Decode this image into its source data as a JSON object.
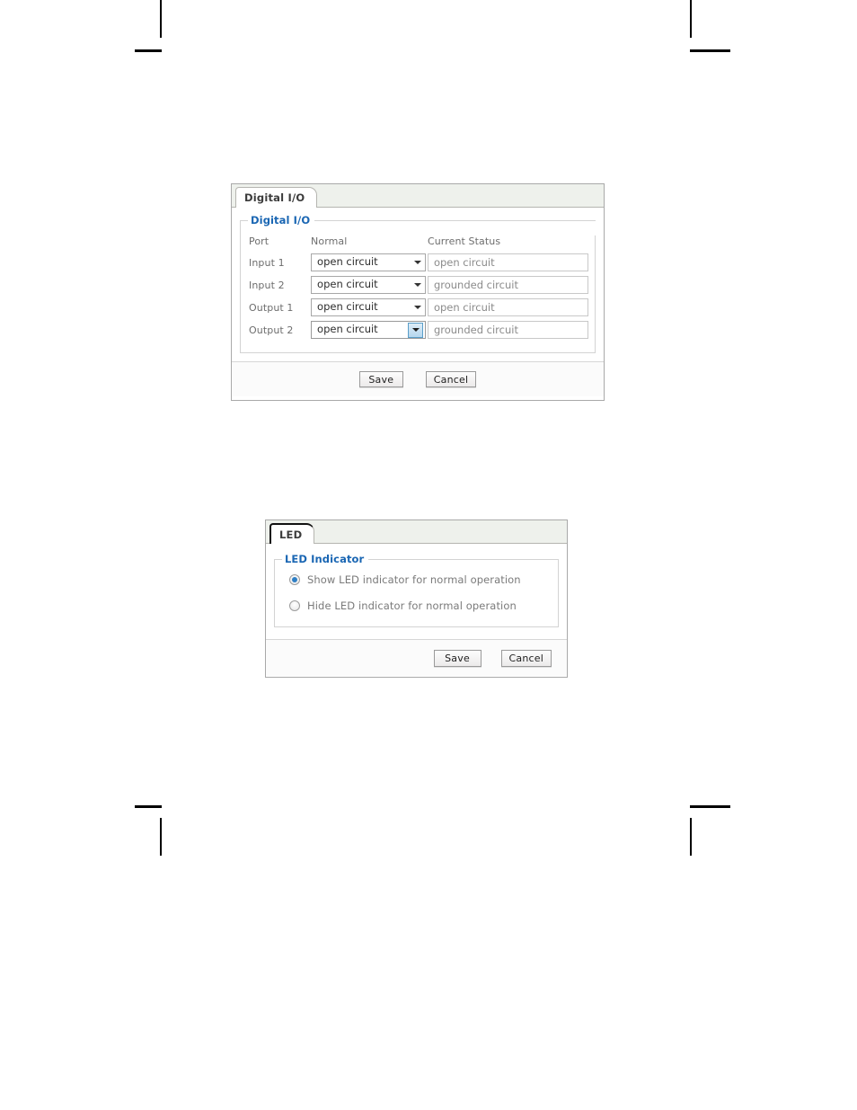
{
  "page": {
    "background_color": "#ffffff",
    "crop_marks": [
      "top-left",
      "top-right",
      "bottom-left",
      "bottom-right"
    ]
  },
  "digital_io_panel": {
    "tab": {
      "label": "Digital I/O"
    },
    "group": {
      "legend": "Digital I/O"
    },
    "table": {
      "columns": [
        "Port",
        "Normal",
        "Current Status"
      ],
      "rows": [
        {
          "port": "Input 1",
          "normal": "open circuit",
          "status": "open circuit",
          "focused": false
        },
        {
          "port": "Input 2",
          "normal": "open circuit",
          "status": "grounded circuit",
          "focused": false
        },
        {
          "port": "Output 1",
          "normal": "open circuit",
          "status": "open circuit",
          "focused": false
        },
        {
          "port": "Output 2",
          "normal": "open circuit",
          "status": "grounded circuit",
          "focused": true
        }
      ]
    },
    "select_options": [
      "open circuit",
      "grounded circuit"
    ],
    "buttons": {
      "save": "Save",
      "cancel": "Cancel"
    }
  },
  "led_panel": {
    "tab": {
      "label": "LED"
    },
    "group": {
      "legend": "LED Indicator"
    },
    "options": [
      {
        "label": "Show LED indicator for normal operation",
        "selected": true
      },
      {
        "label": "Hide LED indicator for normal operation",
        "selected": false
      }
    ],
    "buttons": {
      "save": "Save",
      "cancel": "Cancel"
    }
  },
  "colors": {
    "legend_blue": "#1a66b3",
    "radio_selected": "#2f7fc4",
    "tabstrip_background": "#eef1ec",
    "panel_border": "#a9a9a9",
    "label_gray": "#6d6d6d",
    "readonly_text_gray": "#8b8b8b",
    "focus_arrow_blue": "#5a9ec9"
  }
}
